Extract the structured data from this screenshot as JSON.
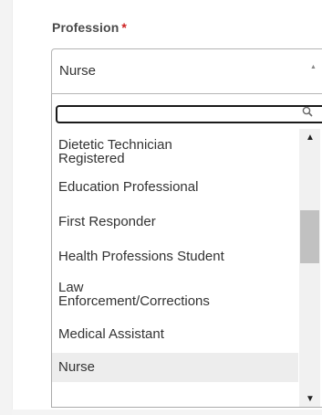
{
  "field": {
    "label": "Profession",
    "required_marker": "*"
  },
  "select": {
    "selected_value": "Nurse"
  },
  "search": {
    "value": ""
  },
  "options": [
    {
      "label": "Dietetic Technician\nRegistered",
      "selected": false
    },
    {
      "label": "Education Professional",
      "selected": false
    },
    {
      "label": "First Responder",
      "selected": false
    },
    {
      "label": "Health Professions Student",
      "selected": false
    },
    {
      "label": "Law\nEnforcement/Corrections",
      "selected": false
    },
    {
      "label": "Medical Assistant",
      "selected": false
    },
    {
      "label": "Nurse",
      "selected": true
    }
  ],
  "colors": {
    "required": "#cc1f1f",
    "selected_option_bg": "#ededed",
    "scroll_thumb": "#c1c1c1"
  },
  "icons": {
    "select_arrow": "caret-up-icon",
    "search": "magnifier-icon",
    "scroll_up": "triangle-up-icon",
    "scroll_down": "triangle-down-icon"
  }
}
